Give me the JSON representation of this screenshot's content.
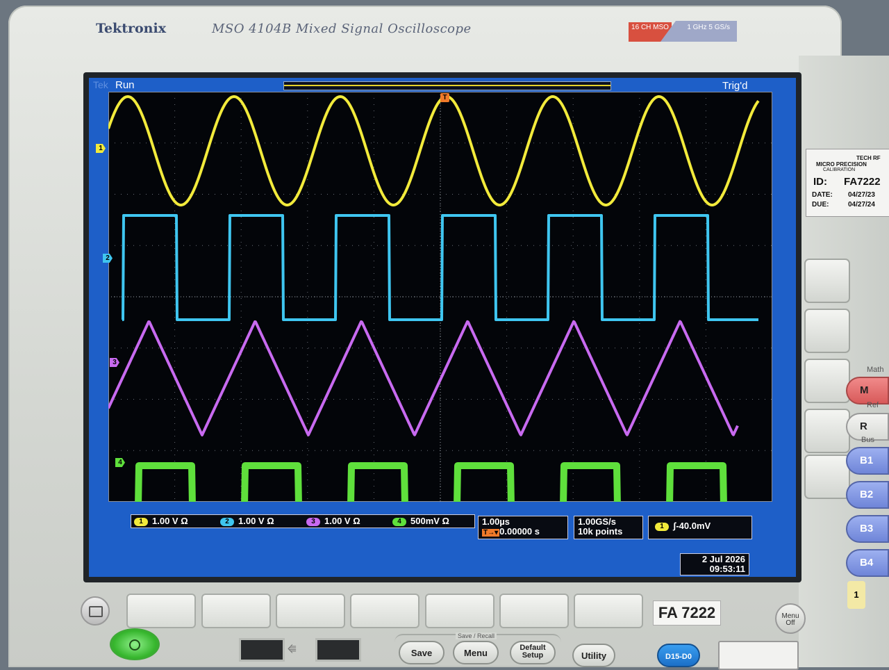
{
  "device": {
    "brand": "Tektronix",
    "model": "MSO 4104B Mixed Signal Oscilloscope",
    "badge_left": "16 CH MSO",
    "badge_right": "1 GHz 5 GS/s"
  },
  "screen": {
    "tek": "Tek",
    "run_status": "Run",
    "trigger_status": "Trig'd",
    "trigger_marker": "T"
  },
  "channels": [
    {
      "id": "1",
      "scale": "1.00 V",
      "coupling": "Ω",
      "color": "#f2ea3b",
      "waveform": "sine"
    },
    {
      "id": "2",
      "scale": "1.00 V",
      "coupling": "Ω",
      "color": "#3fc6f0",
      "waveform": "square"
    },
    {
      "id": "3",
      "scale": "1.00 V",
      "coupling": "Ω",
      "color": "#c86af0",
      "waveform": "triangle"
    },
    {
      "id": "4",
      "scale": "500mV",
      "coupling": "Ω",
      "color": "#5fe03c",
      "waveform": "square"
    }
  ],
  "horizontal": {
    "scale": "1.00µs",
    "position": "0.00000 s"
  },
  "acquisition": {
    "sample_rate": "1.00GS/s",
    "record_length": "10k points"
  },
  "trigger": {
    "source": "1",
    "level": "-40.0mV"
  },
  "datetime": {
    "date": "2 Jul  2026",
    "time": "09:53:11"
  },
  "asset_label": "FA 7222",
  "calibration_sticker": {
    "org_line1": "TECH RF",
    "org_line2": "MICRO PRECISION",
    "org_line3": "CALIBRATION",
    "id_label": "ID:",
    "id_value": "FA7222",
    "date_label": "DATE:",
    "date_value": "04/27/23",
    "due_label": "DUE:",
    "due_value": "04/27/24"
  },
  "front_panel": {
    "save_recall_label": "Save / Recall",
    "save": "Save",
    "menu": "Menu",
    "default_setup": "Default Setup",
    "utility": "Utility",
    "digital": "D15-D0",
    "menu_off": "Menu Off",
    "math_label": "Math",
    "math_key": "M",
    "ref_label": "Ref",
    "ref_key": "R",
    "bus_label": "Bus",
    "bus": [
      "B1",
      "B2",
      "B3",
      "B4"
    ],
    "channel_one": "1"
  }
}
